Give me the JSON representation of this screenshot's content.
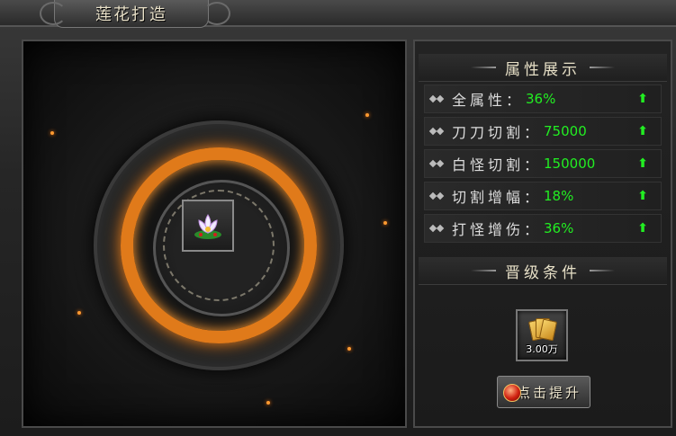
{
  "window": {
    "title": "莲花打造"
  },
  "attributes_panel": {
    "header": "属性展示",
    "rows": [
      {
        "label": "全属性：",
        "value": "36%"
      },
      {
        "label": "刀刀切割：",
        "value": "75000"
      },
      {
        "label": "白怪切割：",
        "value": "150000"
      },
      {
        "label": "切割增幅：",
        "value": "18%"
      },
      {
        "label": "打怪增伤：",
        "value": "36%"
      }
    ],
    "arrow_icon": "up-arrow-icon",
    "value_color": "#22ee22"
  },
  "upgrade": {
    "header": "晋级条件",
    "cost_text": "3.00万",
    "button_label": "点击提升"
  },
  "item": {
    "icon": "lotus-icon"
  }
}
